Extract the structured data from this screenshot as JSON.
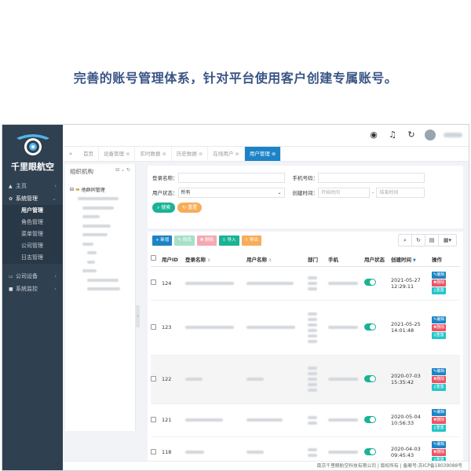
{
  "headline": "完善的账号管理体系，针对平台使用客户创建专属账号。",
  "brand": {
    "name": "千里眼航空",
    "accent": "#1c84c6"
  },
  "sidebar": {
    "items": [
      {
        "label": "主页",
        "icon": "home-icon"
      },
      {
        "label": "系统管理",
        "icon": "gear-icon",
        "open": true
      },
      {
        "label": "公司设备",
        "icon": "device-icon"
      },
      {
        "label": "系统监控",
        "icon": "camera-icon"
      }
    ],
    "sub_items": [
      "用户管理",
      "角色管理",
      "菜单管理",
      "公司管理",
      "日志管理"
    ]
  },
  "tabs": {
    "items": [
      "首页",
      "设备管理",
      "实时数据",
      "历史数据",
      "在线用户",
      "用户管理"
    ],
    "active": "用户管理"
  },
  "org": {
    "title": "组织机构",
    "root": "他群同管理"
  },
  "search": {
    "login_label": "登录名称：",
    "phone_label": "手机号码：",
    "status_label": "用户状态：",
    "status_value": "所有",
    "time_label": "创建时间：",
    "start_placeholder": "开始时间",
    "end_placeholder": "结束时间",
    "search_btn": "搜索",
    "reset_btn": "重置"
  },
  "toolbar": {
    "add": "新增",
    "edit": "修改",
    "delete": "删除",
    "import": "导入",
    "export": "导出"
  },
  "table": {
    "columns": [
      "用户ID",
      "登录名称",
      "用户名称",
      "部门",
      "手机",
      "用户状态",
      "创建时间",
      "操作"
    ],
    "rows": [
      {
        "id": "124",
        "date": "2021-05-27",
        "time": "12:29:11"
      },
      {
        "id": "123",
        "date": "2021-05-25",
        "time": "14:01:48"
      },
      {
        "id": "122",
        "date": "2020-07-03",
        "time": "15:35:42"
      },
      {
        "id": "121",
        "date": "2020-05-04",
        "time": "10:56:33"
      },
      {
        "id": "118",
        "date": "2020-04-03",
        "time": "09:45:43"
      }
    ],
    "op_edit": "编辑",
    "op_delete": "删除",
    "op_reset": "重置"
  },
  "footer": "南京千里眼航空科技有限公司 | 版权所有 | 备案号:苏ICP备18039088号"
}
